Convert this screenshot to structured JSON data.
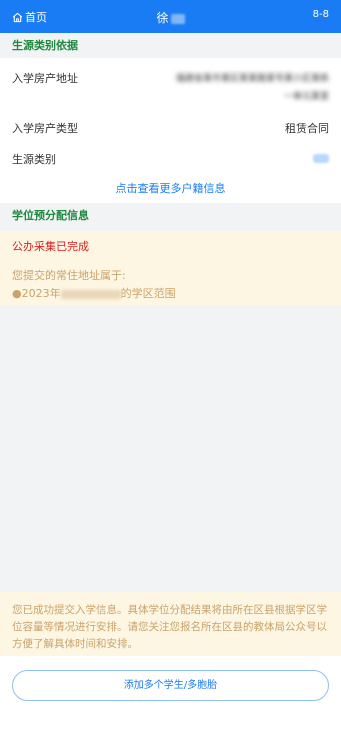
{
  "header": {
    "home_label": "首页",
    "title_prefix": "徐",
    "right_label": "8-8"
  },
  "section1": {
    "title": "生源类别依据",
    "address_label": "入学房产地址",
    "address_value_line1": "福建省某市某区某某路某号某小区某栋",
    "address_value_line2": "一单元某室",
    "type_label": "入学房产类型",
    "type_value": "租赁合同",
    "category_label": "生源类别",
    "more_link": "点击查看更多户籍信息"
  },
  "section2": {
    "title": "学位预分配信息",
    "status": "公办采集已完成",
    "line1": "您提交的常住地址属于:",
    "line2_prefix": "●2023年",
    "line2_suffix": "的学区范围"
  },
  "bottom": {
    "note": "您已成功提交入学信息。具体学位分配结果将由所在区县根据学区学位容量等情况进行安排。请您关注您报名所在区县的教体局公众号以方便了解具体时间和安排。",
    "add_button": "添加多个学生/多胞胎"
  }
}
